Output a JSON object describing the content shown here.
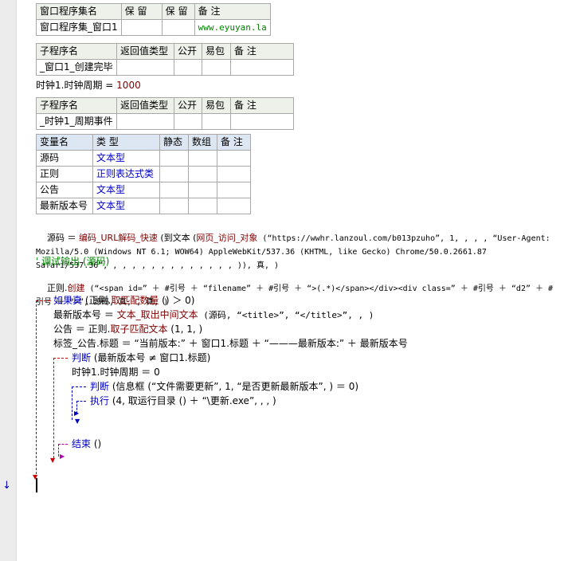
{
  "table_set": {
    "headers": [
      "窗口程序集名",
      "保 留",
      "保 留",
      "备 注"
    ],
    "row": [
      "窗口程序集_窗口1",
      "",
      "",
      "www.eyuyan.la"
    ]
  },
  "table_sub1": {
    "headers": [
      "子程序名",
      "返回值类型",
      "公开",
      "易包",
      "备 注"
    ],
    "row": [
      "_窗口1_创建完毕",
      "",
      "",
      "",
      ""
    ]
  },
  "assign_timer": {
    "lhs": "时钟1.时钟周期",
    "op": "=",
    "value": "1000"
  },
  "table_sub2": {
    "headers": [
      "子程序名",
      "返回值类型",
      "公开",
      "易包",
      "备 注"
    ],
    "row": [
      "_时钟1_周期事件",
      "",
      "",
      "",
      ""
    ]
  },
  "table_vars": {
    "headers": [
      "变量名",
      "类 型",
      "静态",
      "数组",
      "备 注"
    ],
    "rows": [
      [
        "源码",
        "文本型",
        "",
        "",
        ""
      ],
      [
        "正则",
        "正则表达式类",
        "",
        "",
        ""
      ],
      [
        "公告",
        "文本型",
        "",
        "",
        ""
      ],
      [
        "最新版本号",
        "文本型",
        "",
        "",
        ""
      ]
    ]
  },
  "code": {
    "l1a": "源码 ＝ ",
    "l1b": "编码_URL解码_快速",
    "l1c": " (到文本 (",
    "l1d": "网页_访问_对象",
    "l1e": " (“https://wwhr.lanzoul.com/b013pzuho”, 1, , , , “User-Agent: Mozilla/5.0 (Windows NT 6.1; WOW64) AppleWebKit/537.36 (KHTML, like Gecko) Chrome/50.0.2661.87 Safari/537.36”, , , , , , , , , , , , , , )), 真, )",
    "l2": "' 调试输出 (源码)",
    "l3a": "正则.",
    "l3b": "创建",
    "l3c": " (“<span id=” ＋ #引号 ＋ “filename” ＋ #引号 ＋ “>(.*)</span></div><div class=” ＋ #引号 ＋ “d2” ＋ #引号 ＋ “>”, 源码, 真, , 真, )",
    "l4a": "如果真",
    "l4b": " (正则.",
    "l4c": "取匹配数量",
    "l4d": " () ＞ 0)",
    "l5a": "最新版本号 ＝ ",
    "l5b": "文本_取出中间文本",
    "l5c": " (源码, “<title>”, “</title>”, , )",
    "l6a": "公告 ＝ 正则.",
    "l6b": "取子匹配文本",
    "l6c": " (1, 1, )",
    "l7": "标签_公告.标题 ＝ “当前版本:” ＋ 窗口1.标题 ＋ “———最新版本:” ＋ 最新版本号",
    "l8a": "判断",
    "l8b": " (最新版本号 ≠ 窗口1.标题)",
    "l9a": "时钟1.时钟周期 ＝ 0",
    "l10a": "判断",
    "l10b": " (信息框 (“文件需要更新”, 1, “是否更新最新版本”, ) ＝ 0)",
    "l11a": "执行",
    "l11b": " (4, 取运行目录 () ＋ “\\更新.exe”, , , )",
    "l12a": "结束",
    "l12b": " ()"
  },
  "colors": {
    "keyword": "#0000c8",
    "flow_red": "#cc0000",
    "flow_blue": "#0000c0",
    "flow_purple": "#b000b0"
  }
}
